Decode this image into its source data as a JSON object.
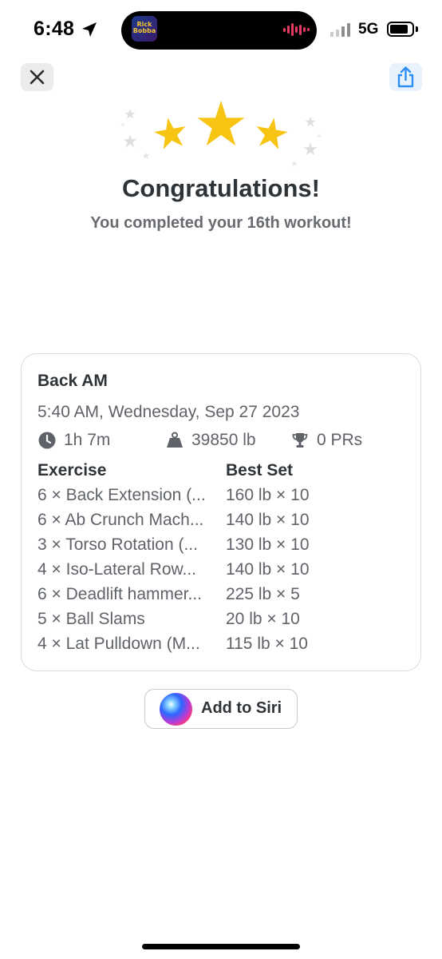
{
  "status_bar": {
    "time": "6:48",
    "network": "5G",
    "island_app_label": "Rick Bobba"
  },
  "header": {
    "close_icon": "x-mark-icon",
    "share_icon": "share-icon"
  },
  "celebration": {
    "title": "Congratulations!",
    "subtitle": "You completed your 16th workout!",
    "star_color": "#f7c413"
  },
  "workout": {
    "name": "Back AM",
    "datetime": "5:40 AM, Wednesday, Sep 27 2023",
    "stats": {
      "duration": "1h 7m",
      "volume": "39850 lb",
      "prs": "0 PRs"
    },
    "columns": {
      "exercise": "Exercise",
      "best_set": "Best Set"
    },
    "exercises": [
      {
        "exercise": "6 × Back Extension (...",
        "best_set": "160 lb × 10"
      },
      {
        "exercise": "6 × Ab Crunch Mach...",
        "best_set": "140 lb × 10"
      },
      {
        "exercise": "3 × Torso Rotation (...",
        "best_set": "130 lb × 10"
      },
      {
        "exercise": "4 × Iso-Lateral Row...",
        "best_set": "140 lb × 10"
      },
      {
        "exercise": "6 × Deadlift hammer...",
        "best_set": "225 lb × 5"
      },
      {
        "exercise": "5 × Ball Slams",
        "best_set": "20 lb × 10"
      },
      {
        "exercise": "4 × Lat Pulldown (M...",
        "best_set": "115 lb × 10"
      }
    ]
  },
  "siri": {
    "label": "Add to Siri"
  }
}
